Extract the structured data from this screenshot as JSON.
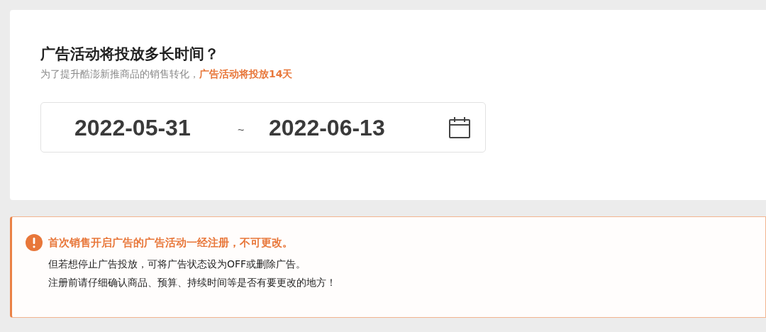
{
  "duration_card": {
    "title": "广告活动将投放多长时间？",
    "subtitle": "为了提升酷澎新推商品的销售转化，**广告活动将投放14天**",
    "date_range": {
      "start": "2022-05-31",
      "separator": "~",
      "end": "2022-06-13"
    }
  },
  "notice": {
    "heading": "首次销售开启广告的广告活动一经注册，不可更改。",
    "lines": [
      "但若想停止广告投放，可将广告状态设为OFF或删除广告。",
      "注册前请仔细确认商品、预算、持续时间等是否有要更改的地方！"
    ]
  }
}
